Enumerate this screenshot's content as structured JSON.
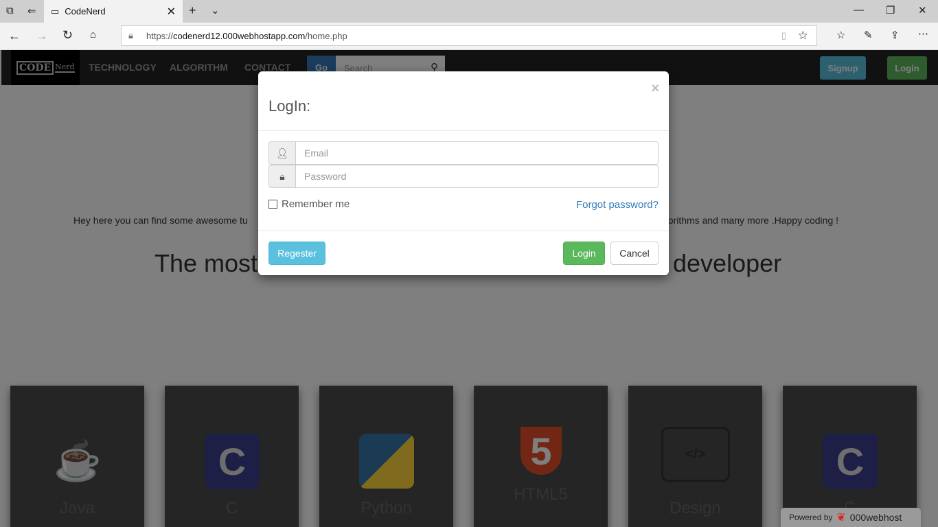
{
  "browser": {
    "tab_title": "CodeNerd",
    "url_prefix": "https://",
    "url_domain": "codenerd12.000webhostapp.com",
    "url_path": "/home.php"
  },
  "nav": {
    "logo_code": "CODE",
    "logo_nerd": "Nerd",
    "links": [
      "TECHNOLOGY",
      "ALGORITHM",
      "CONTACT"
    ],
    "go": "Go",
    "search_placeholder": "Search",
    "signup": "Signup",
    "login": "Login"
  },
  "main": {
    "intro_left": "Hey here you can find some awesome tu",
    "intro_right": "gorithms and many more .Happy coding !",
    "headline_left": "The most",
    "headline_right": "developer",
    "cards": [
      "Java",
      "C",
      "Python",
      "HTML5",
      "Design",
      "C"
    ]
  },
  "modal": {
    "title": "LogIn:",
    "close": "×",
    "email_placeholder": "Email",
    "password_placeholder": "Password",
    "remember": "Remember me",
    "forgot": "Forgot password?",
    "register": "Regester",
    "login": "Login",
    "cancel": "Cancel"
  },
  "footer": {
    "powered_by": "Powered by",
    "brand": "000webhost"
  },
  "colors": {
    "signup": "#5bc0de",
    "login": "#5cb85c",
    "link": "#337ab7",
    "go": "#337ab7"
  }
}
